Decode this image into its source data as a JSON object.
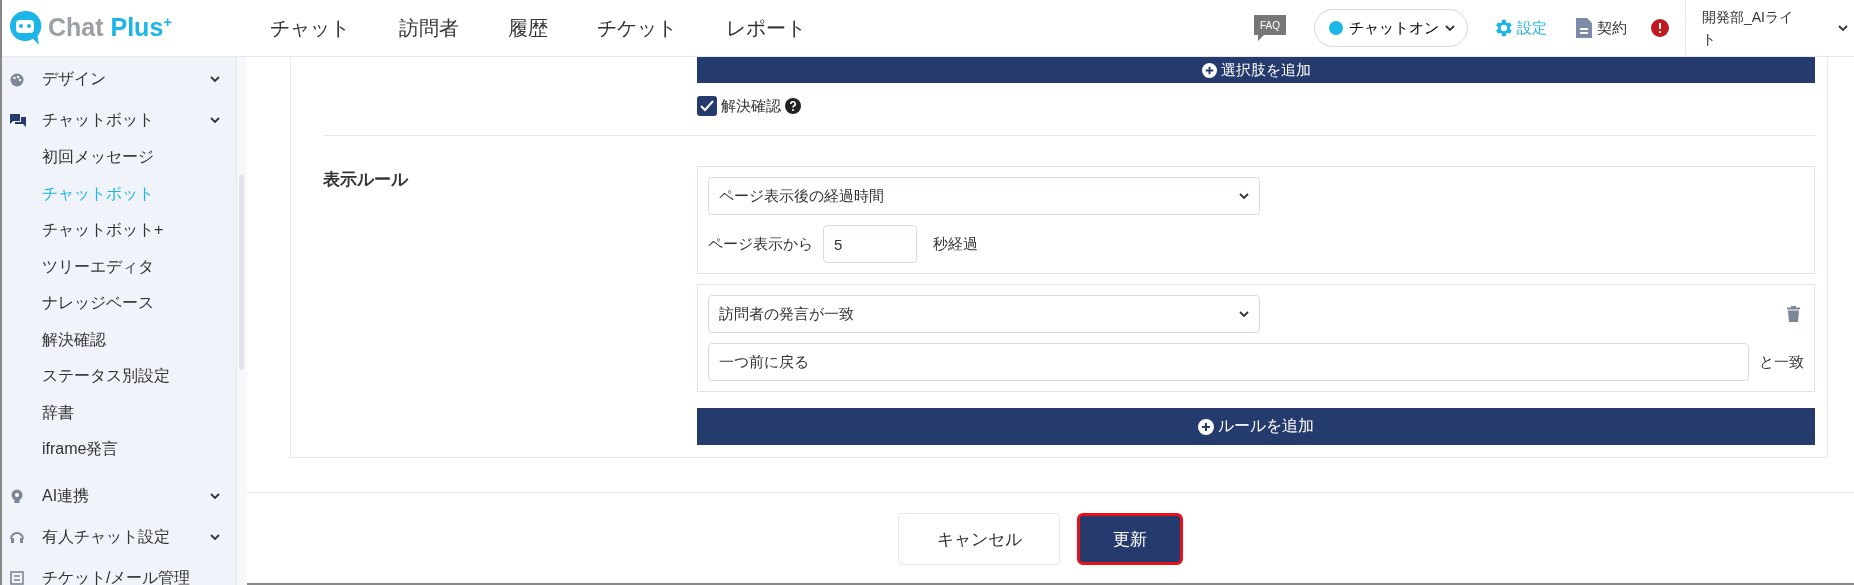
{
  "header": {
    "logo": {
      "text": "Chat ",
      "accent": "Plus",
      "sup": "+"
    },
    "nav": [
      {
        "label": "チャット"
      },
      {
        "label": "訪問者"
      },
      {
        "label": "履歴"
      },
      {
        "label": "チケット"
      },
      {
        "label": "レポート"
      }
    ],
    "faq": "FAQ",
    "status": {
      "label": "チャットオン",
      "color": "#1bb5e8"
    },
    "settings": "設定",
    "contract": "契約",
    "user": "開発部_AIライト"
  },
  "sidebar": {
    "items": [
      {
        "label": "デザイン"
      },
      {
        "label": "チャットボット",
        "children": [
          {
            "label": "初回メッセージ",
            "selected": false
          },
          {
            "label": "チャットボット",
            "selected": true
          },
          {
            "label": "チャットボット+",
            "selected": false
          },
          {
            "label": "ツリーエディタ",
            "selected": false
          },
          {
            "label": "ナレッジベース",
            "selected": false
          },
          {
            "label": "解決確認",
            "selected": false
          },
          {
            "label": "ステータス別設定",
            "selected": false
          },
          {
            "label": "辞書",
            "selected": false
          },
          {
            "label": "iframe発言",
            "selected": false
          }
        ]
      },
      {
        "label": "AI連携"
      },
      {
        "label": "有人チャット設定"
      },
      {
        "label": "チケット/メール管理"
      }
    ]
  },
  "content": {
    "add_choice_button": "選択肢を追加",
    "resolution_check": {
      "label": "解決確認",
      "checked": true
    },
    "display_rules": {
      "label": "表示ルール",
      "rules": [
        {
          "kind": "elapsed",
          "condition": "ページ表示後の経過時間",
          "prefix": "ページ表示から",
          "value": "5",
          "suffix": "秒経過",
          "deletable": false
        },
        {
          "kind": "match",
          "condition": "訪問者の発言が一致",
          "value": "一つ前に戻る",
          "suffix": "と一致",
          "deletable": true
        }
      ],
      "add_button": "ルールを追加"
    }
  },
  "footer": {
    "buttons": [
      {
        "label": "キャンセル",
        "kind": "secondary",
        "focused": false
      },
      {
        "label": "更新",
        "kind": "primary",
        "focused": true
      }
    ]
  }
}
